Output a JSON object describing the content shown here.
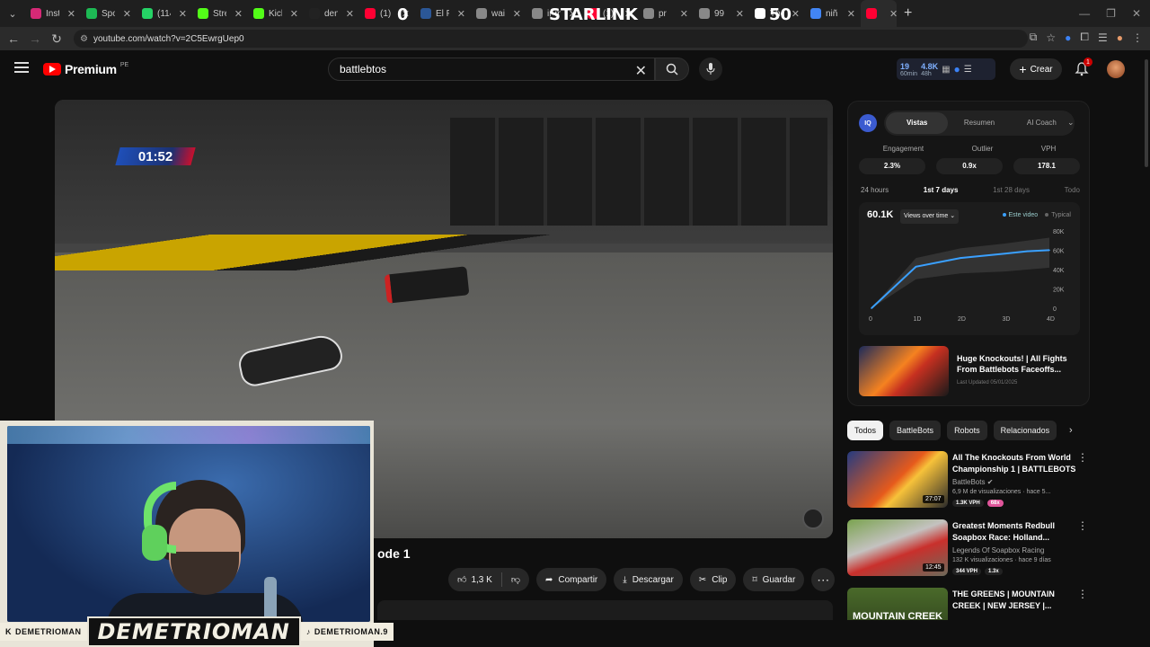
{
  "browser": {
    "tabs": [
      {
        "label": "Insta",
        "color": "#d62976"
      },
      {
        "label": "Spo",
        "color": "#1db954"
      },
      {
        "label": "(114",
        "color": "#25d366"
      },
      {
        "label": "Stre",
        "color": "#53fc18"
      },
      {
        "label": "Kick",
        "color": "#53fc18"
      },
      {
        "label": "den",
        "color": "#222222"
      },
      {
        "label": "(1)",
        "color": "#ff0033"
      },
      {
        "label": "El P",
        "color": "#2b5797"
      },
      {
        "label": "wai",
        "color": "#888888"
      },
      {
        "label": "ir m",
        "color": "#888888"
      },
      {
        "label": "(1) I",
        "color": "#ff0033"
      },
      {
        "label": "pr",
        "color": "#888888"
      },
      {
        "label": "99",
        "color": "#888888"
      },
      {
        "label": "The",
        "color": "#ffffff"
      },
      {
        "label": "niñ",
        "color": "#4285f4"
      },
      {
        "label": "",
        "color": "#ff0033"
      }
    ],
    "url": "youtube.com/watch?v=2C5EwrgUep0",
    "overlay": {
      "score_left": "0",
      "title": "STARLINK",
      "score_right": "50"
    }
  },
  "header": {
    "logo_text": "Premium",
    "country": "PE",
    "search_value": "battlebtos",
    "ext_stats": {
      "v1": "19",
      "l1": "60min",
      "v2": "4.8K",
      "l2": "48h"
    },
    "create_label": "Crear",
    "notif_count": "1"
  },
  "video": {
    "timer": "01:52",
    "title_fragment": "ode 1"
  },
  "actions": {
    "likes": "1,3 K",
    "share": "Compartir",
    "download": "Descargar",
    "clip": "Clip",
    "save": "Guardar"
  },
  "streamer": {
    "left_handle": "DEMETRIOMAN",
    "name": "DEMETRIOMAN",
    "right_handle": "DEMETRIOMAN.9"
  },
  "panel": {
    "logo": "IQ",
    "tabs": [
      "Vistas",
      "Resumen",
      "AI Coach"
    ],
    "metrics": [
      {
        "label": "Engagement",
        "value": "2.3%"
      },
      {
        "label": "Outlier",
        "value": "0.9x"
      },
      {
        "label": "VPH",
        "value": "178.1"
      }
    ],
    "ranges": [
      "24 hours",
      "1st 7 days",
      "1st 28 days",
      "Todo"
    ],
    "views": "60.1K",
    "views_selector": "Views over time ⌄",
    "legend": [
      "Este video",
      "Typical"
    ],
    "featured": {
      "title": "Huge Knockouts! | All Fights From Battlebots Faceoffs...",
      "updated": "Last Updated 05/01/2025"
    }
  },
  "chart_data": {
    "type": "area",
    "x": [
      "0",
      "1D",
      "2D",
      "3D",
      "4D"
    ],
    "y_ticks": [
      "80K",
      "60K",
      "40K",
      "20K",
      "0"
    ],
    "ylim": [
      0,
      80000
    ],
    "series": [
      {
        "name": "Este video",
        "values": [
          0,
          43000,
          52000,
          56500,
          59000,
          60100
        ]
      },
      {
        "name": "Typical",
        "band_low": [
          0,
          30000,
          36000,
          38000,
          40000,
          42000
        ],
        "band_high": [
          0,
          52000,
          62000,
          67000,
          70000,
          73000
        ]
      }
    ],
    "x_positions_days": [
      0,
      1,
      2,
      3,
      3.5,
      4
    ],
    "legend": "top-right"
  },
  "chips": [
    "Todos",
    "BattleBots",
    "Robots",
    "Relacionados"
  ],
  "recommendations": [
    {
      "title": "All The Knockouts From World Championship 1 | BATTLEBOTS",
      "channel": "BattleBots ✔",
      "meta": "6,9 M de visualizaciones · hace 5...",
      "duration": "27:07",
      "tags": [
        "1.3K VPH",
        "68x"
      ]
    },
    {
      "title": "Greatest Moments Redbull Soapbox Race: Holland...",
      "channel": "Legends Of Soapbox Racing",
      "meta": "132 K visualizaciones · hace 9 días",
      "duration": "12:45",
      "tags": [
        "344 VPH",
        "1.3x"
      ]
    },
    {
      "title": "THE GREENS | MOUNTAIN CREEK | NEW JERSEY |...",
      "channel": "",
      "meta": "",
      "duration": "",
      "tags": [],
      "thumb_text": "MOUNTAIN CREEK"
    }
  ]
}
